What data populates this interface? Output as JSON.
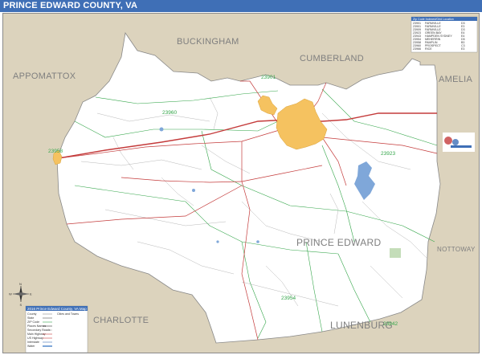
{
  "title": "PRINCE EDWARD COUNTY, VA",
  "colors": {
    "title_bar": "#3f6fb6",
    "neighbor": "#dcd3bd",
    "county": "#ffffff",
    "urban": "#f5c260",
    "water": "#7fa7d9",
    "zip_boundary": "#34a64a",
    "road": "#c43b3b",
    "minor_road": "#666666"
  },
  "neighbors": [
    "BUCKINGHAM",
    "CUMBERLAND",
    "APPOMATTOX",
    "AMELIA",
    "NOTTOWAY",
    "LUNENBURG",
    "CHARLOTTE"
  ],
  "county_label": "PRINCE EDWARD",
  "zip_codes": [
    "23901",
    "23960",
    "23958",
    "23923",
    "23954",
    "23942"
  ],
  "zip_table": {
    "header": "Zip Code  Indexed/Grid Location",
    "rows": [
      {
        "zip": "23901",
        "name": "FARMVILLE",
        "grid": "D3"
      },
      {
        "zip": "23901",
        "name": "FARMVILLE",
        "grid": "E3"
      },
      {
        "zip": "23909",
        "name": "FARMVILLE",
        "grid": "D3"
      },
      {
        "zip": "23923",
        "name": "GREEN BAY",
        "grid": "E4"
      },
      {
        "zip": "23943",
        "name": "HAMPDEN SYDNEY",
        "grid": "E4"
      },
      {
        "zip": "23954",
        "name": "MEHERRIN",
        "grid": "D5"
      },
      {
        "zip": "23958",
        "name": "PAMPLIN",
        "grid": "B3"
      },
      {
        "zip": "23960",
        "name": "PROSPECT",
        "grid": "C3"
      },
      {
        "zip": "23966",
        "name": "RICE",
        "grid": "E3"
      }
    ]
  },
  "legend": {
    "title": "2016 Prince Edward County, VA Map",
    "column_header": "Cities and Towns",
    "items": [
      "County",
      "State",
      "ZIP Code",
      "Places Names",
      "Secondary Roads",
      "Main Highway",
      "US Highway",
      "Interstate",
      "Water"
    ]
  },
  "compass": {
    "north": "N",
    "south": "S",
    "east": "E",
    "west": "W"
  }
}
